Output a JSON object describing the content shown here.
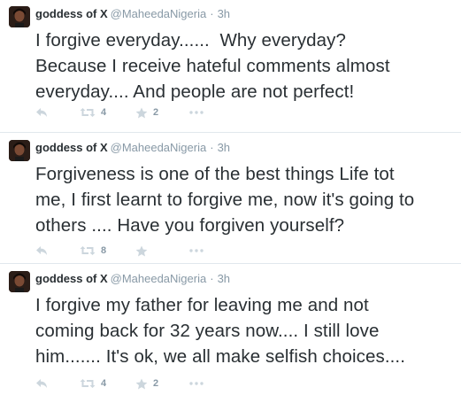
{
  "colors": {
    "text": "#292f33",
    "muted": "#8899a6",
    "icon": "#ccd6dd",
    "divider": "#e1e8ed"
  },
  "tweets": [
    {
      "name": "goddess of X",
      "handle": "@MaheedaNigeria",
      "separator": "·",
      "time": "3h",
      "text": "I forgive everyday......  Why everyday?\nBecause I receive hateful comments almost\neveryday.... And people are not perfect!",
      "retweets": "4",
      "favorites": "2",
      "icons": [
        "reply-icon",
        "retweet-icon",
        "favorite-icon",
        "more-icon"
      ]
    },
    {
      "name": "goddess of X",
      "handle": "@MaheedaNigeria",
      "separator": "·",
      "time": "3h",
      "text": "Forgiveness is one of the best things Life tot\nme, I first learnt to forgive me, now it's going to\nothers .... Have you forgiven yourself?",
      "retweets": "8",
      "favorites": "",
      "icons": [
        "reply-icon",
        "retweet-icon",
        "favorite-icon",
        "more-icon"
      ]
    },
    {
      "name": "goddess of X",
      "handle": "@MaheedaNigeria",
      "separator": "·",
      "time": "3h",
      "text": "I forgive my father for leaving me and not\ncoming back for 32 years now.... I still love\nhim....... It's ok, we all make selfish choices....",
      "retweets": "4",
      "favorites": "2",
      "icons": [
        "reply-icon",
        "retweet-icon",
        "favorite-icon",
        "more-icon"
      ]
    }
  ]
}
